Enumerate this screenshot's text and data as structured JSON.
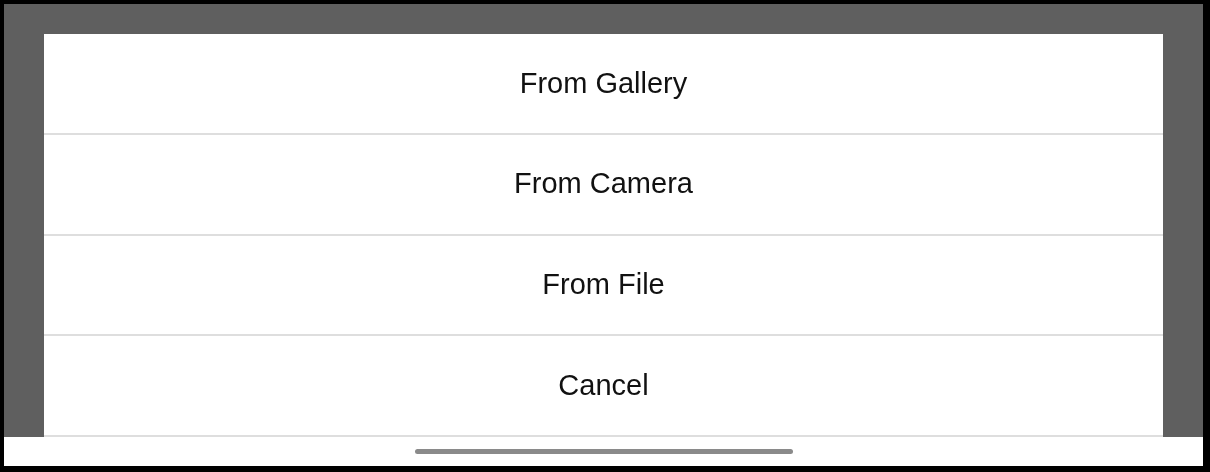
{
  "action_sheet": {
    "options": [
      {
        "label": "From Gallery"
      },
      {
        "label": "From Camera"
      },
      {
        "label": "From File"
      },
      {
        "label": "Cancel"
      }
    ]
  }
}
